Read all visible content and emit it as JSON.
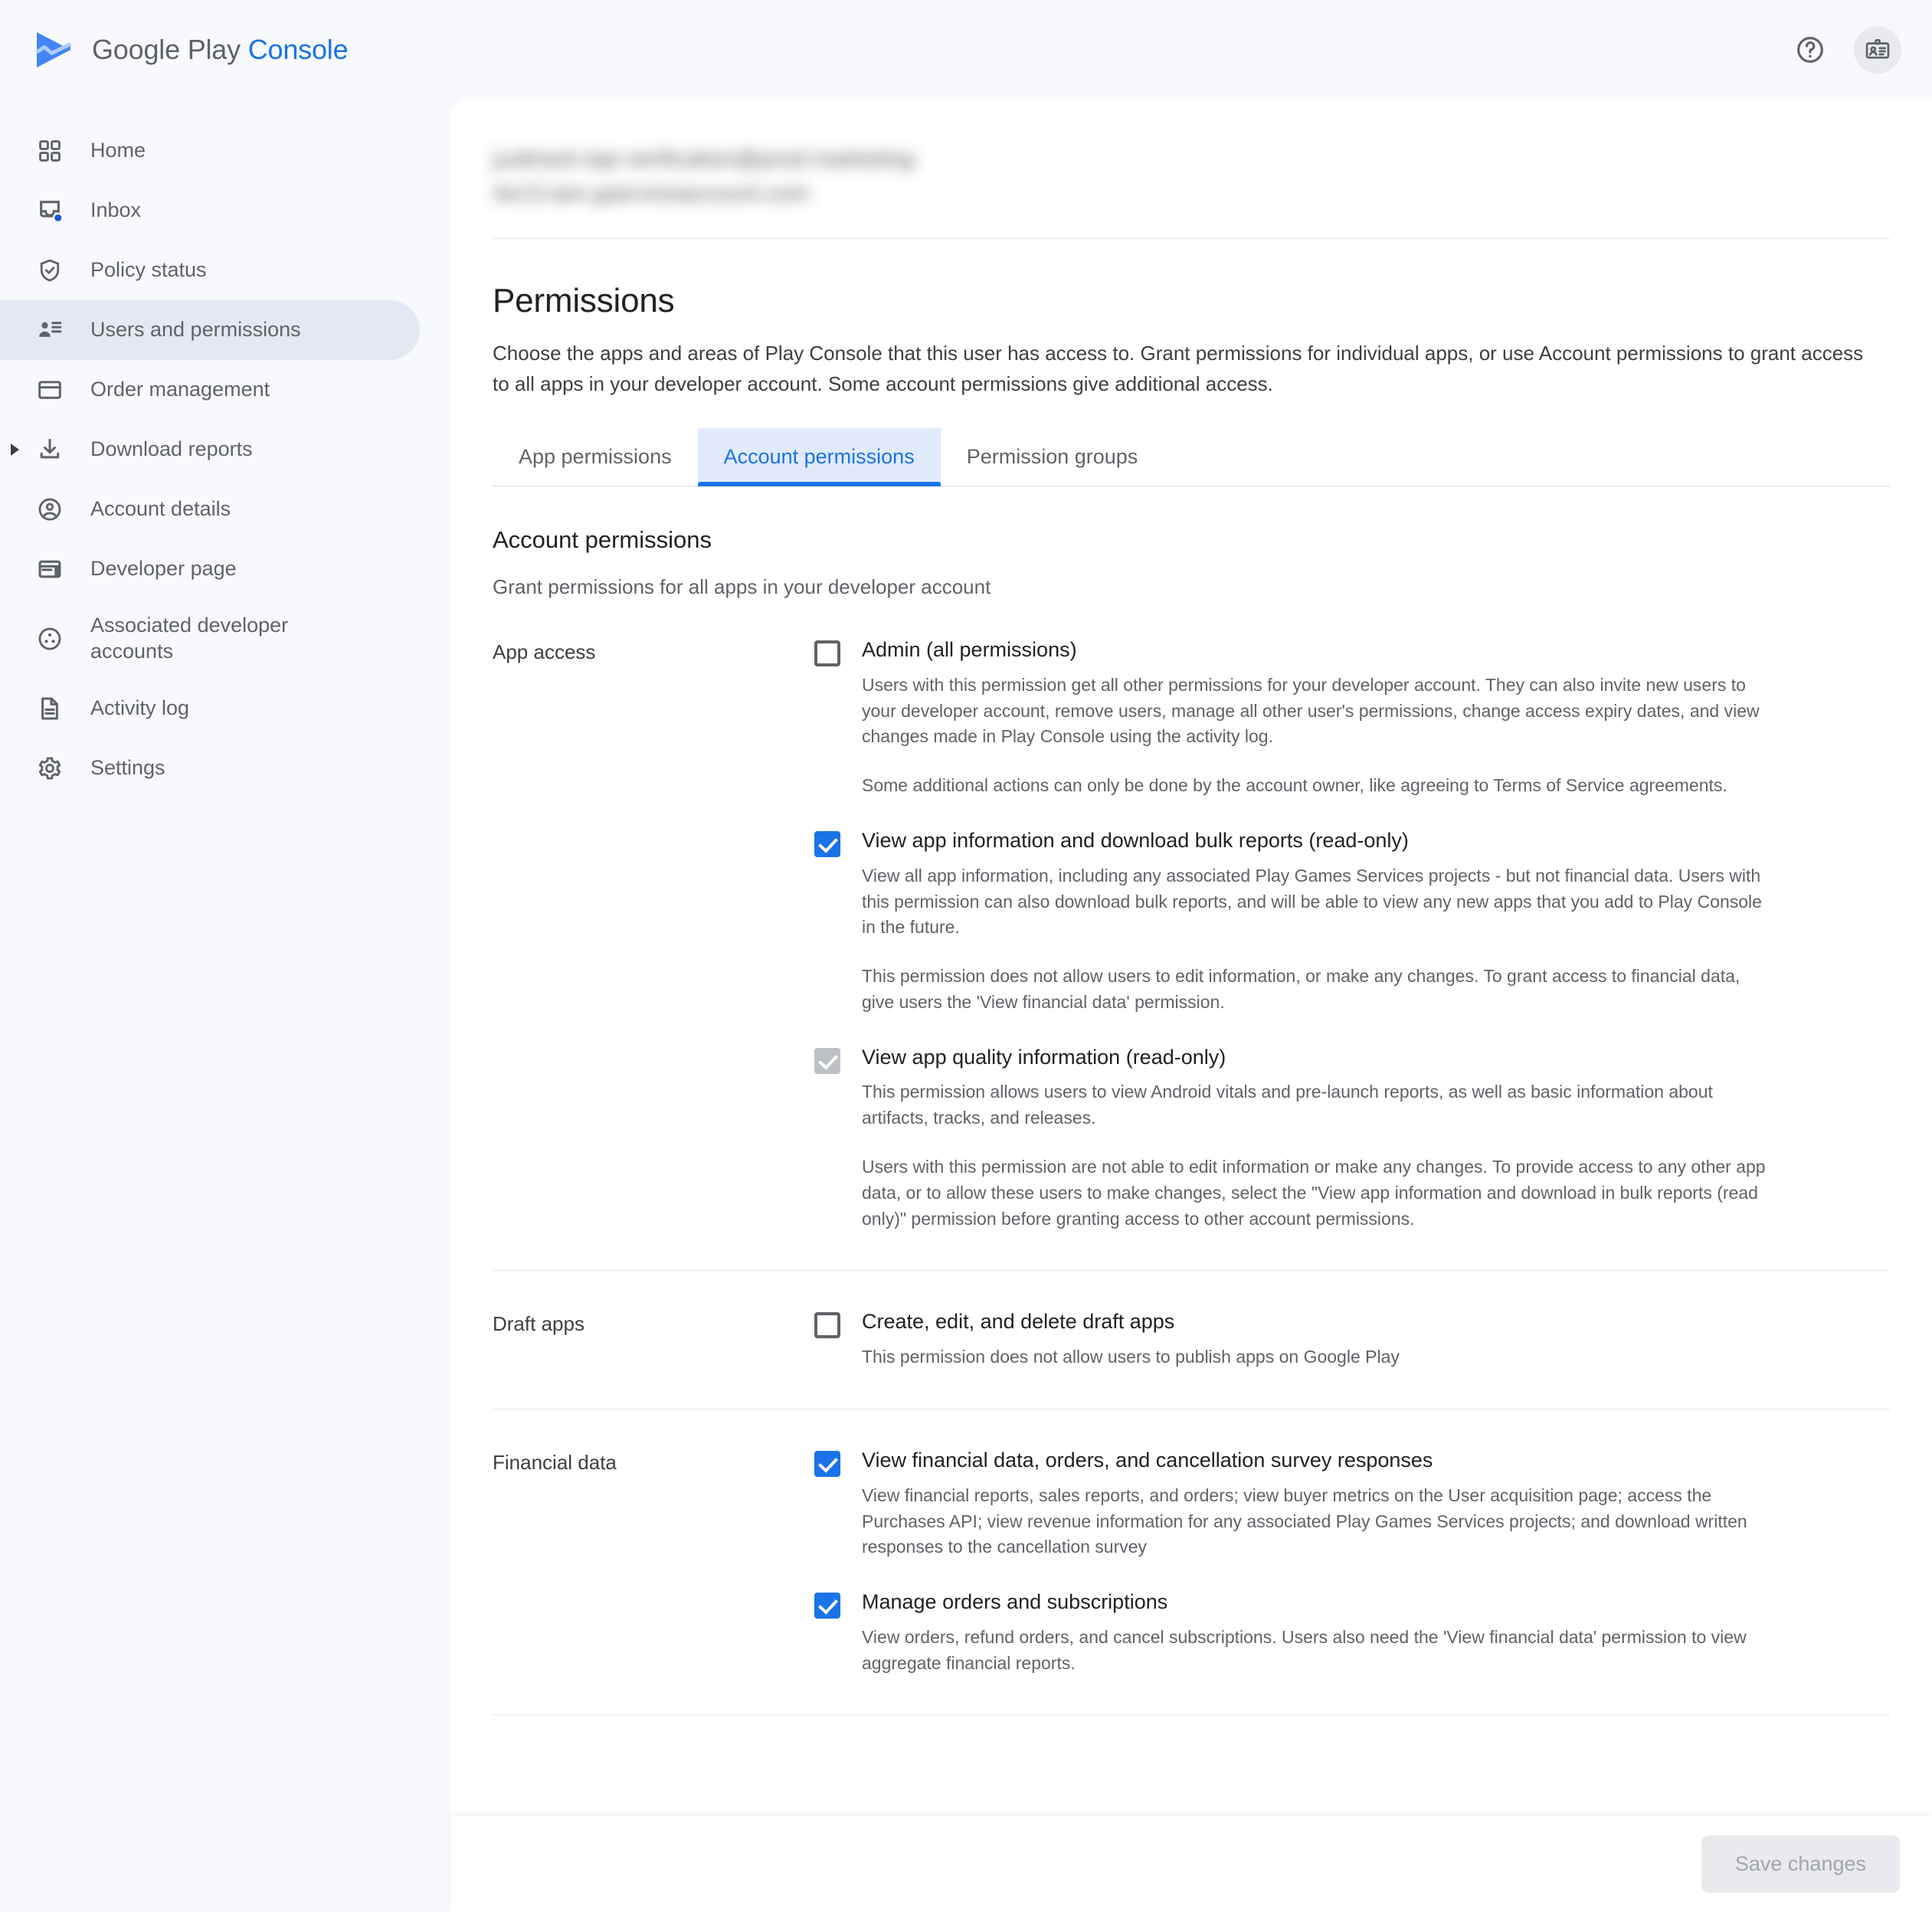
{
  "brand": {
    "name_primary": "Google Play",
    "name_secondary": "Console",
    "logo_icon": "play-console-logo"
  },
  "topbar": {
    "help_icon": "help-circle-icon",
    "account_badge_icon": "id-badge-icon"
  },
  "sidebar": {
    "items": [
      {
        "label": "Home",
        "icon": "grid-apps-icon",
        "active": false,
        "expandable": false
      },
      {
        "label": "Inbox",
        "icon": "inbox-icon",
        "active": false,
        "expandable": false,
        "badge_dot": true
      },
      {
        "label": "Policy status",
        "icon": "shield-check-icon",
        "active": false,
        "expandable": false
      },
      {
        "label": "Users and permissions",
        "icon": "users-permissions-icon",
        "active": true,
        "expandable": false
      },
      {
        "label": "Order management",
        "icon": "credit-card-icon",
        "active": false,
        "expandable": false
      },
      {
        "label": "Download reports",
        "icon": "download-icon",
        "active": false,
        "expandable": true
      },
      {
        "label": "Account details",
        "icon": "account-circle-icon",
        "active": false,
        "expandable": false
      },
      {
        "label": "Developer page",
        "icon": "developer-page-icon",
        "active": false,
        "expandable": false
      },
      {
        "label": "Associated developer\naccounts",
        "icon": "associated-accounts-icon",
        "active": false,
        "expandable": false
      },
      {
        "label": "Activity log",
        "icon": "document-lines-icon",
        "active": false,
        "expandable": false
      },
      {
        "label": "Settings",
        "icon": "gear-icon",
        "active": false,
        "expandable": false
      }
    ]
  },
  "main": {
    "user_email_redacted_line1": "justtrack-tap-verification@prod-marketing-",
    "user_email_redacted_line2": "4e13.iam.gserviceaccount.com",
    "page_title": "Permissions",
    "page_description": "Choose the apps and areas of Play Console that this user has access to. Grant permissions for individual apps, or use Account permissions to grant access to all apps in your developer account. Some account permissions give additional access.",
    "tabs": [
      {
        "label": "App permissions",
        "active": false
      },
      {
        "label": "Account permissions",
        "active": true
      },
      {
        "label": "Permission groups",
        "active": false
      }
    ],
    "section_title": "Account permissions",
    "section_description": "Grant permissions for all apps in your developer account",
    "groups": [
      {
        "label": "App access",
        "items": [
          {
            "name": "Admin (all permissions)",
            "state": "unchecked",
            "descriptions": [
              "Users with this permission get all other permissions for your developer account. They can also invite new users to your developer account, remove users, manage all other user's permissions, change access expiry dates, and view changes made in Play Console using the activity log.",
              "Some additional actions can only be done by the account owner, like agreeing to Terms of Service agreements."
            ]
          },
          {
            "name": "View app information and download bulk reports (read-only)",
            "state": "checked",
            "descriptions": [
              "View all app information, including any associated Play Games Services projects - but not financial data. Users with this permission can also download bulk reports, and will be able to view any new apps that you add to Play Console in the future.",
              "This permission does not allow users to edit information, or make any changes. To grant access to financial data, give users the 'View financial data' permission."
            ]
          },
          {
            "name": "View app quality information (read-only)",
            "state": "disabled",
            "descriptions": [
              "This permission allows users to view Android vitals and pre-launch reports, as well as basic information about artifacts, tracks, and releases.",
              "Users with this permission are not able to edit information or make any changes. To provide access to any other app data, or to allow these users to make changes, select the \"View app information and download in bulk reports (read only)\" permission before granting access to other account permissions."
            ]
          }
        ]
      },
      {
        "label": "Draft apps",
        "items": [
          {
            "name": "Create, edit, and delete draft apps",
            "state": "unchecked",
            "descriptions": [
              "This permission does not allow users to publish apps on Google Play"
            ]
          }
        ]
      },
      {
        "label": "Financial data",
        "items": [
          {
            "name": "View financial data, orders, and cancellation survey responses",
            "state": "checked",
            "descriptions": [
              "View financial reports, sales reports, and orders; view buyer metrics on the User acquisition page; access the Purchases API; view revenue information for any associated Play Games Services projects; and download written responses to the cancellation survey"
            ]
          },
          {
            "name": "Manage orders and subscriptions",
            "state": "checked",
            "descriptions": [
              "View orders, refund orders, and cancel subscriptions. Users also need the 'View financial data' permission to view aggregate financial reports."
            ]
          }
        ]
      }
    ]
  },
  "footer": {
    "save_label": "Save changes",
    "save_enabled": false
  },
  "colors": {
    "accent": "#1a73e8",
    "active_nav_bg": "#e4e8f3",
    "tab_active_bg": "#e1eafd",
    "page_bg": "#f8f9fd",
    "card_bg": "#ffffff"
  }
}
